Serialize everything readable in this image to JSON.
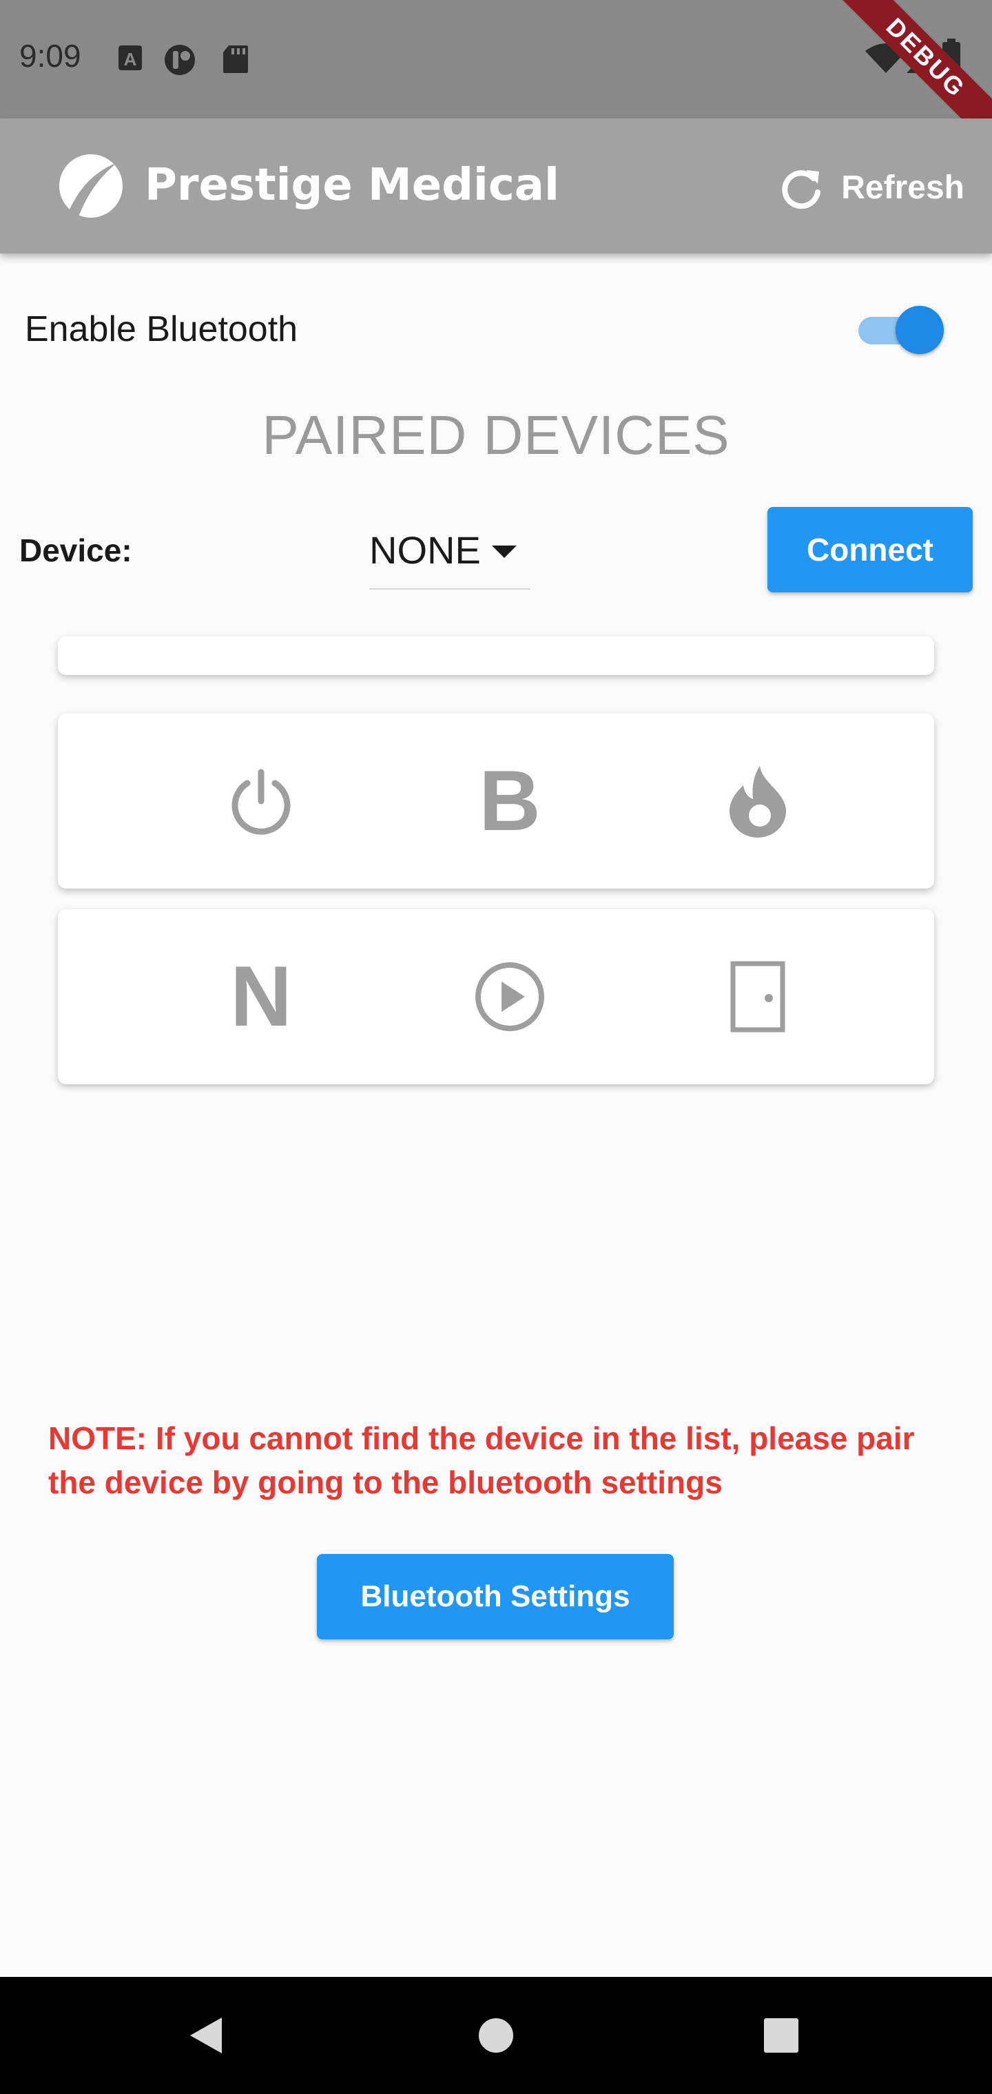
{
  "status_bar": {
    "time": "9:09"
  },
  "debug_banner": "DEBUG",
  "app_bar": {
    "title": "Prestige Medical",
    "refresh_label": "Refresh"
  },
  "bluetooth": {
    "enable_label": "Enable Bluetooth",
    "enabled": true
  },
  "paired_devices": {
    "title": "PAIRED DEVICES",
    "device_label": "Device:",
    "selected_device": "NONE",
    "connect_label": "Connect"
  },
  "controls": {
    "row1": [
      "power-icon",
      "b-letter-icon",
      "flame-icon"
    ],
    "row2": [
      "n-letter-icon",
      "play-circle-icon",
      "door-icon"
    ],
    "b_letter": "B",
    "n_letter": "N"
  },
  "note": "NOTE: If you cannot find the device in the list, please pair the device by going to the bluetooth settings",
  "bluetooth_settings_label": "Bluetooth Settings",
  "colors": {
    "primary": "#2196f3",
    "switch_thumb": "#1e88e5",
    "note_red": "#e53935",
    "app_bar": "#a2a2a2",
    "icon_grey": "#9e9e9e"
  }
}
